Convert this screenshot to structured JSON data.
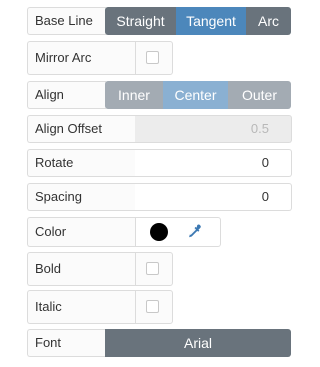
{
  "base_line": {
    "label": "Base Line",
    "options": [
      "Straight",
      "Tangent",
      "Arc"
    ],
    "selected": "Tangent"
  },
  "mirror_arc": {
    "label": "Mirror Arc",
    "checked": false
  },
  "align": {
    "label": "Align",
    "options": [
      "Inner",
      "Center",
      "Outer"
    ],
    "selected": "Center"
  },
  "align_offset": {
    "label": "Align Offset",
    "value": "0.5"
  },
  "rotate": {
    "label": "Rotate",
    "value": "0"
  },
  "spacing": {
    "label": "Spacing",
    "value": "0"
  },
  "color": {
    "label": "Color",
    "swatch": "#000000",
    "eyedropper_icon": "eyedropper-icon",
    "icon_color": "#3b78b2"
  },
  "bold": {
    "label": "Bold",
    "checked": false
  },
  "italic": {
    "label": "Italic",
    "checked": false
  },
  "font": {
    "label": "Font",
    "value": "Arial"
  }
}
